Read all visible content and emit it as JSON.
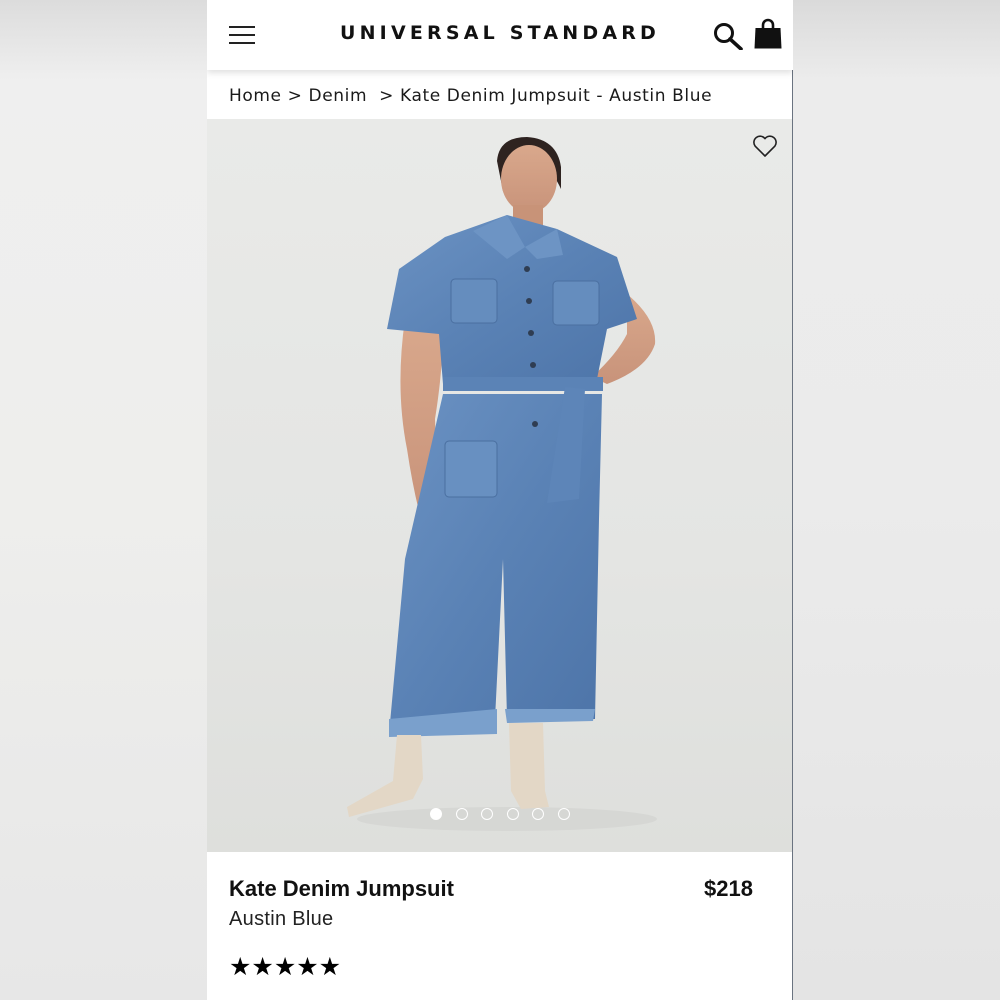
{
  "header": {
    "brand": "UNIVERSAL STANDARD",
    "menu_icon": "hamburger-menu-icon",
    "search_icon": "search-icon",
    "bag_icon": "shopping-bag-icon"
  },
  "breadcrumb": {
    "items": [
      "Home",
      "Denim",
      "Kate Denim Jumpsuit - Austin Blue"
    ],
    "separator": ">"
  },
  "gallery": {
    "favorite_icon": "heart-outline-icon",
    "total_images": 6,
    "active_index": 0
  },
  "product": {
    "name": "Kate Denim Jumpsuit",
    "color": "Austin Blue",
    "price": "$218",
    "rating_stars": "★★★★★",
    "rating": 5
  },
  "colors": {
    "accent": "#111111",
    "denim": "#5f86b8"
  }
}
